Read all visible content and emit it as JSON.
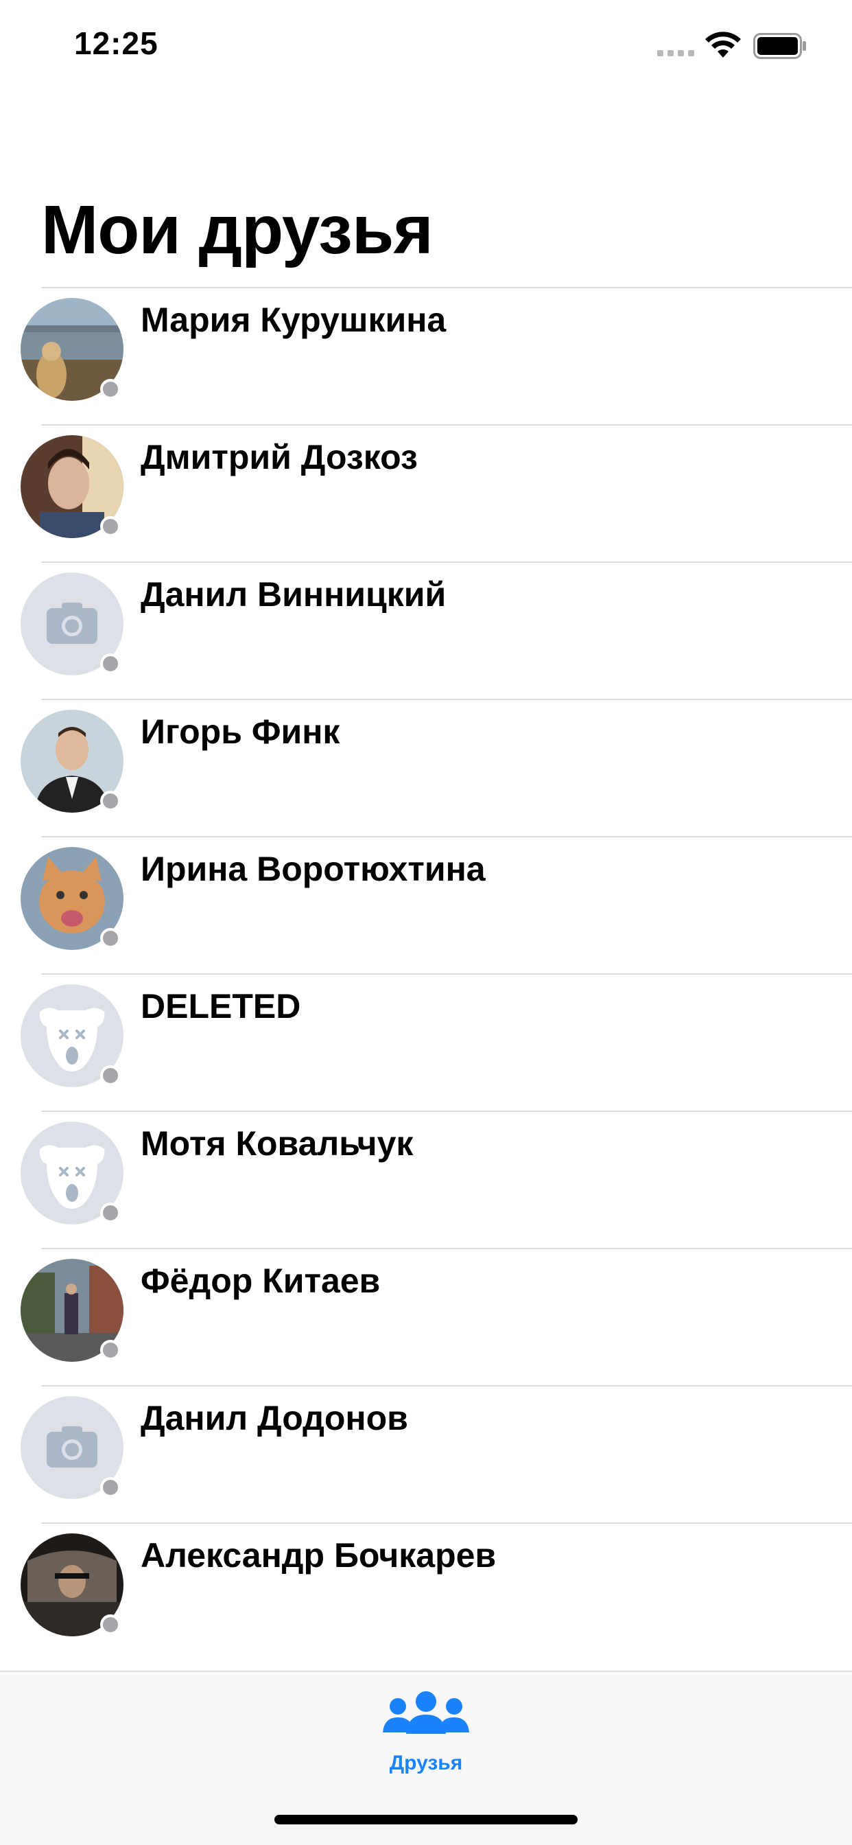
{
  "status_bar": {
    "time": "12:25"
  },
  "title": "Мои друзья",
  "friends": [
    {
      "name": "Мария Курушкина",
      "avatar": "photo-lake"
    },
    {
      "name": "Дмитрий Дозкоз",
      "avatar": "photo-portrait-man"
    },
    {
      "name": "Данил Винницкий",
      "avatar": "camera-placeholder"
    },
    {
      "name": "Игорь Финк",
      "avatar": "photo-suit-man"
    },
    {
      "name": "Ирина Воротюхтина",
      "avatar": "photo-cat"
    },
    {
      "name": "DELETED",
      "avatar": "deleted-dog-placeholder"
    },
    {
      "name": "Мотя Ковальчук",
      "avatar": "deleted-dog-placeholder"
    },
    {
      "name": "Фёдор Китаев",
      "avatar": "photo-street"
    },
    {
      "name": "Данил Додонов",
      "avatar": "camera-placeholder"
    },
    {
      "name": "Александр Бочкарев",
      "avatar": "photo-car"
    }
  ],
  "tab_bar": {
    "tabs": [
      {
        "label": "Друзья",
        "icon": "friends-icon",
        "selected": true
      }
    ]
  },
  "colors": {
    "accent": "#1a82fb",
    "online_dot": "#a5a6aa",
    "placeholder_bg": "#dde1e7",
    "placeholder_icon": "#aab7c6"
  }
}
